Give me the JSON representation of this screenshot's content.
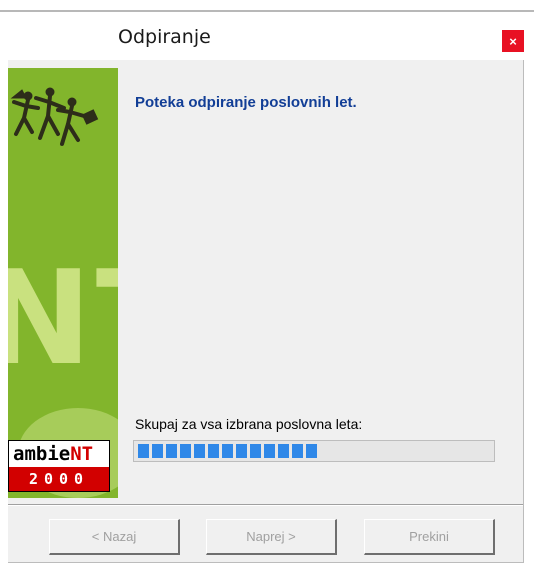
{
  "window": {
    "title": "Odpiranje",
    "close_label": "×"
  },
  "banner": {
    "large_letters": "NT",
    "logo_prefix": "ambie",
    "logo_suffix": "NT",
    "logo_year": "2000"
  },
  "content": {
    "heading": "Poteka odpiranje poslovnih let.",
    "progress_label": "Skupaj za vsa izbrana poslovna leta:",
    "progress_fraction": 0.53
  },
  "buttons": {
    "back_label": "< Nazaj",
    "next_label": "Naprej >",
    "cancel_label": "Prekini"
  },
  "colors": {
    "banner_green": "#82b52c",
    "heading_blue": "#123e96",
    "progress_blue": "#2f88e8",
    "logo_red": "#d20000",
    "close_red": "#e81123"
  },
  "icons": {
    "banner_figures": "running-figures-graphic"
  }
}
